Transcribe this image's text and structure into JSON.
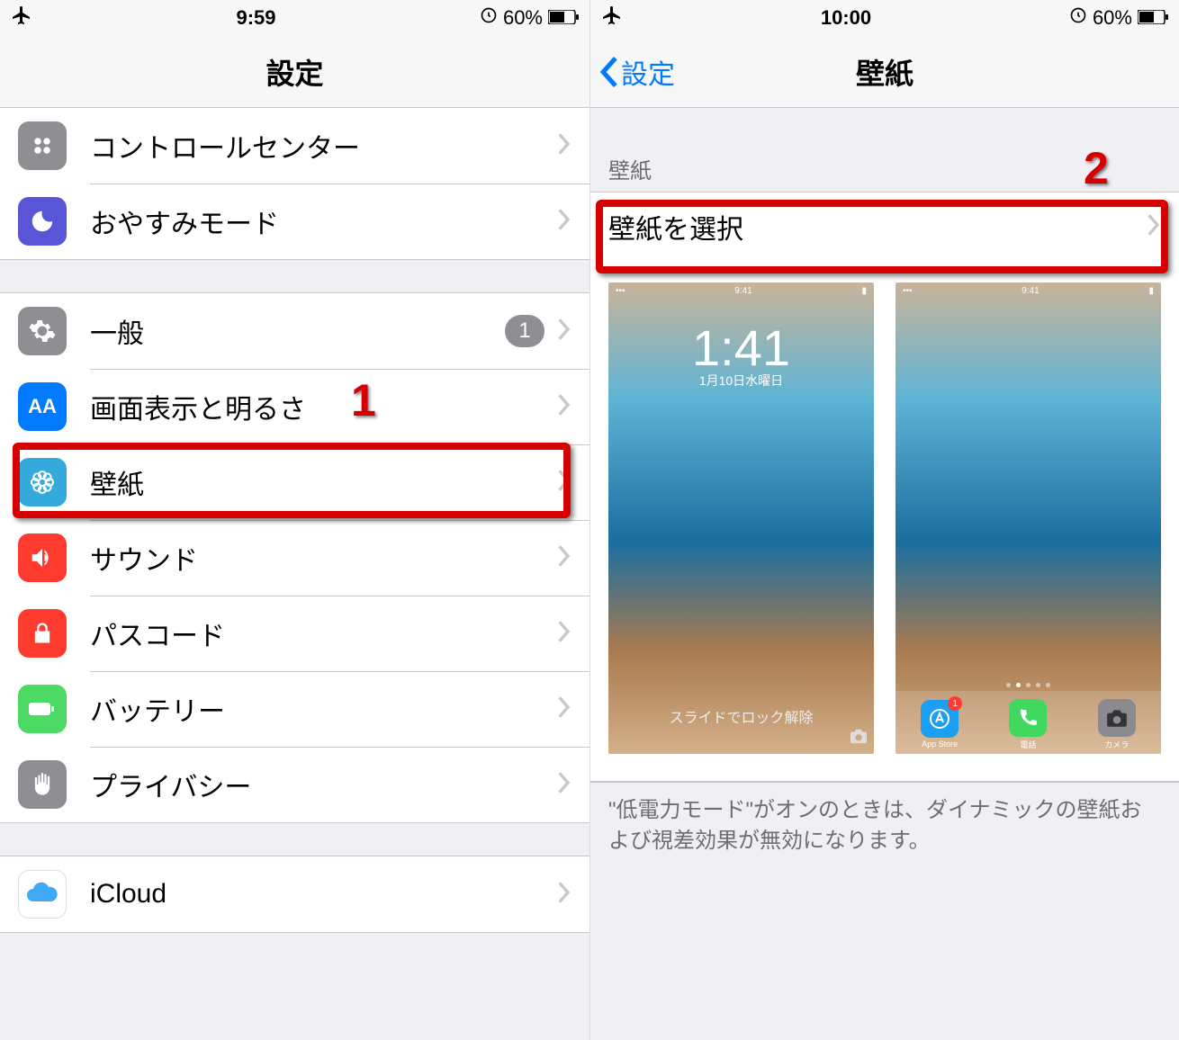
{
  "left": {
    "status": {
      "time": "9:59",
      "battery": "60%"
    },
    "title": "設定",
    "rows_g1": [
      {
        "label": "コントロールセンター"
      },
      {
        "label": "おやすみモード"
      }
    ],
    "rows_g2": [
      {
        "label": "一般",
        "badge": "1"
      },
      {
        "label": "画面表示と明るさ"
      },
      {
        "label": "壁紙"
      },
      {
        "label": "サウンド"
      },
      {
        "label": "パスコード"
      },
      {
        "label": "バッテリー"
      },
      {
        "label": "プライバシー"
      }
    ],
    "rows_g3": [
      {
        "label": "iCloud"
      }
    ],
    "annotation_number": "1"
  },
  "right": {
    "status": {
      "time": "10:00",
      "battery": "60%"
    },
    "back_label": "設定",
    "title": "壁紙",
    "section_header": "壁紙",
    "choose_row": "壁紙を選択",
    "lock_preview": {
      "time": "1:41",
      "date": "1月10日水曜日",
      "slide": "スライドでロック解除"
    },
    "home_preview": {
      "time": "9:41",
      "dock": [
        {
          "name": "App Store",
          "badge": "1"
        },
        {
          "name": "電話"
        },
        {
          "name": "カメラ"
        }
      ]
    },
    "footer": "\"低電力モード\"がオンのときは、ダイナミックの壁紙および視差効果が無効になります。",
    "annotation_number": "2"
  }
}
